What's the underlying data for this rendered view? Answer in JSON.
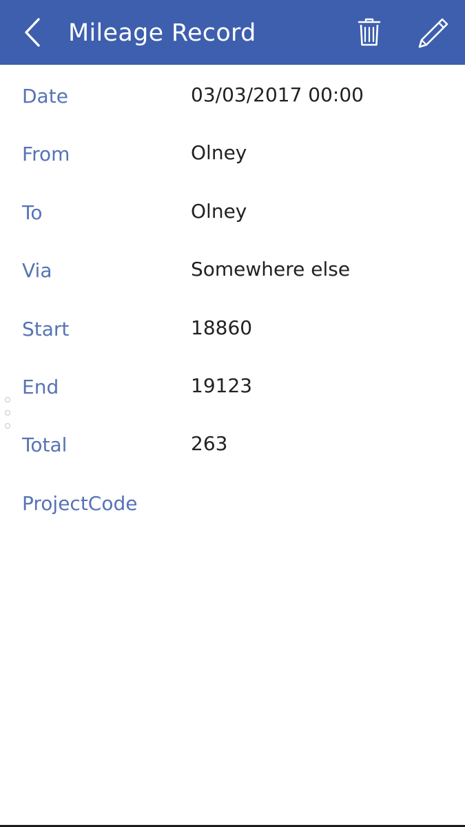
{
  "header": {
    "title": "Mileage Record",
    "back_icon": "chevron-left-icon",
    "delete_icon": "trash-icon",
    "edit_icon": "pencil-icon",
    "background_color": "#3d5fae"
  },
  "record": {
    "fields": [
      {
        "label": "Date",
        "value": "03/03/2017 00:00"
      },
      {
        "label": "From",
        "value": "Olney"
      },
      {
        "label": "To",
        "value": "Olney"
      },
      {
        "label": "Via",
        "value": "Somewhere else"
      },
      {
        "label": "Start",
        "value": "18860"
      },
      {
        "label": "End",
        "value": "19123"
      },
      {
        "label": "Total",
        "value": "263"
      },
      {
        "label": "ProjectCode",
        "value": ""
      }
    ]
  },
  "colors": {
    "label": "#5673b6",
    "value": "#222222"
  }
}
